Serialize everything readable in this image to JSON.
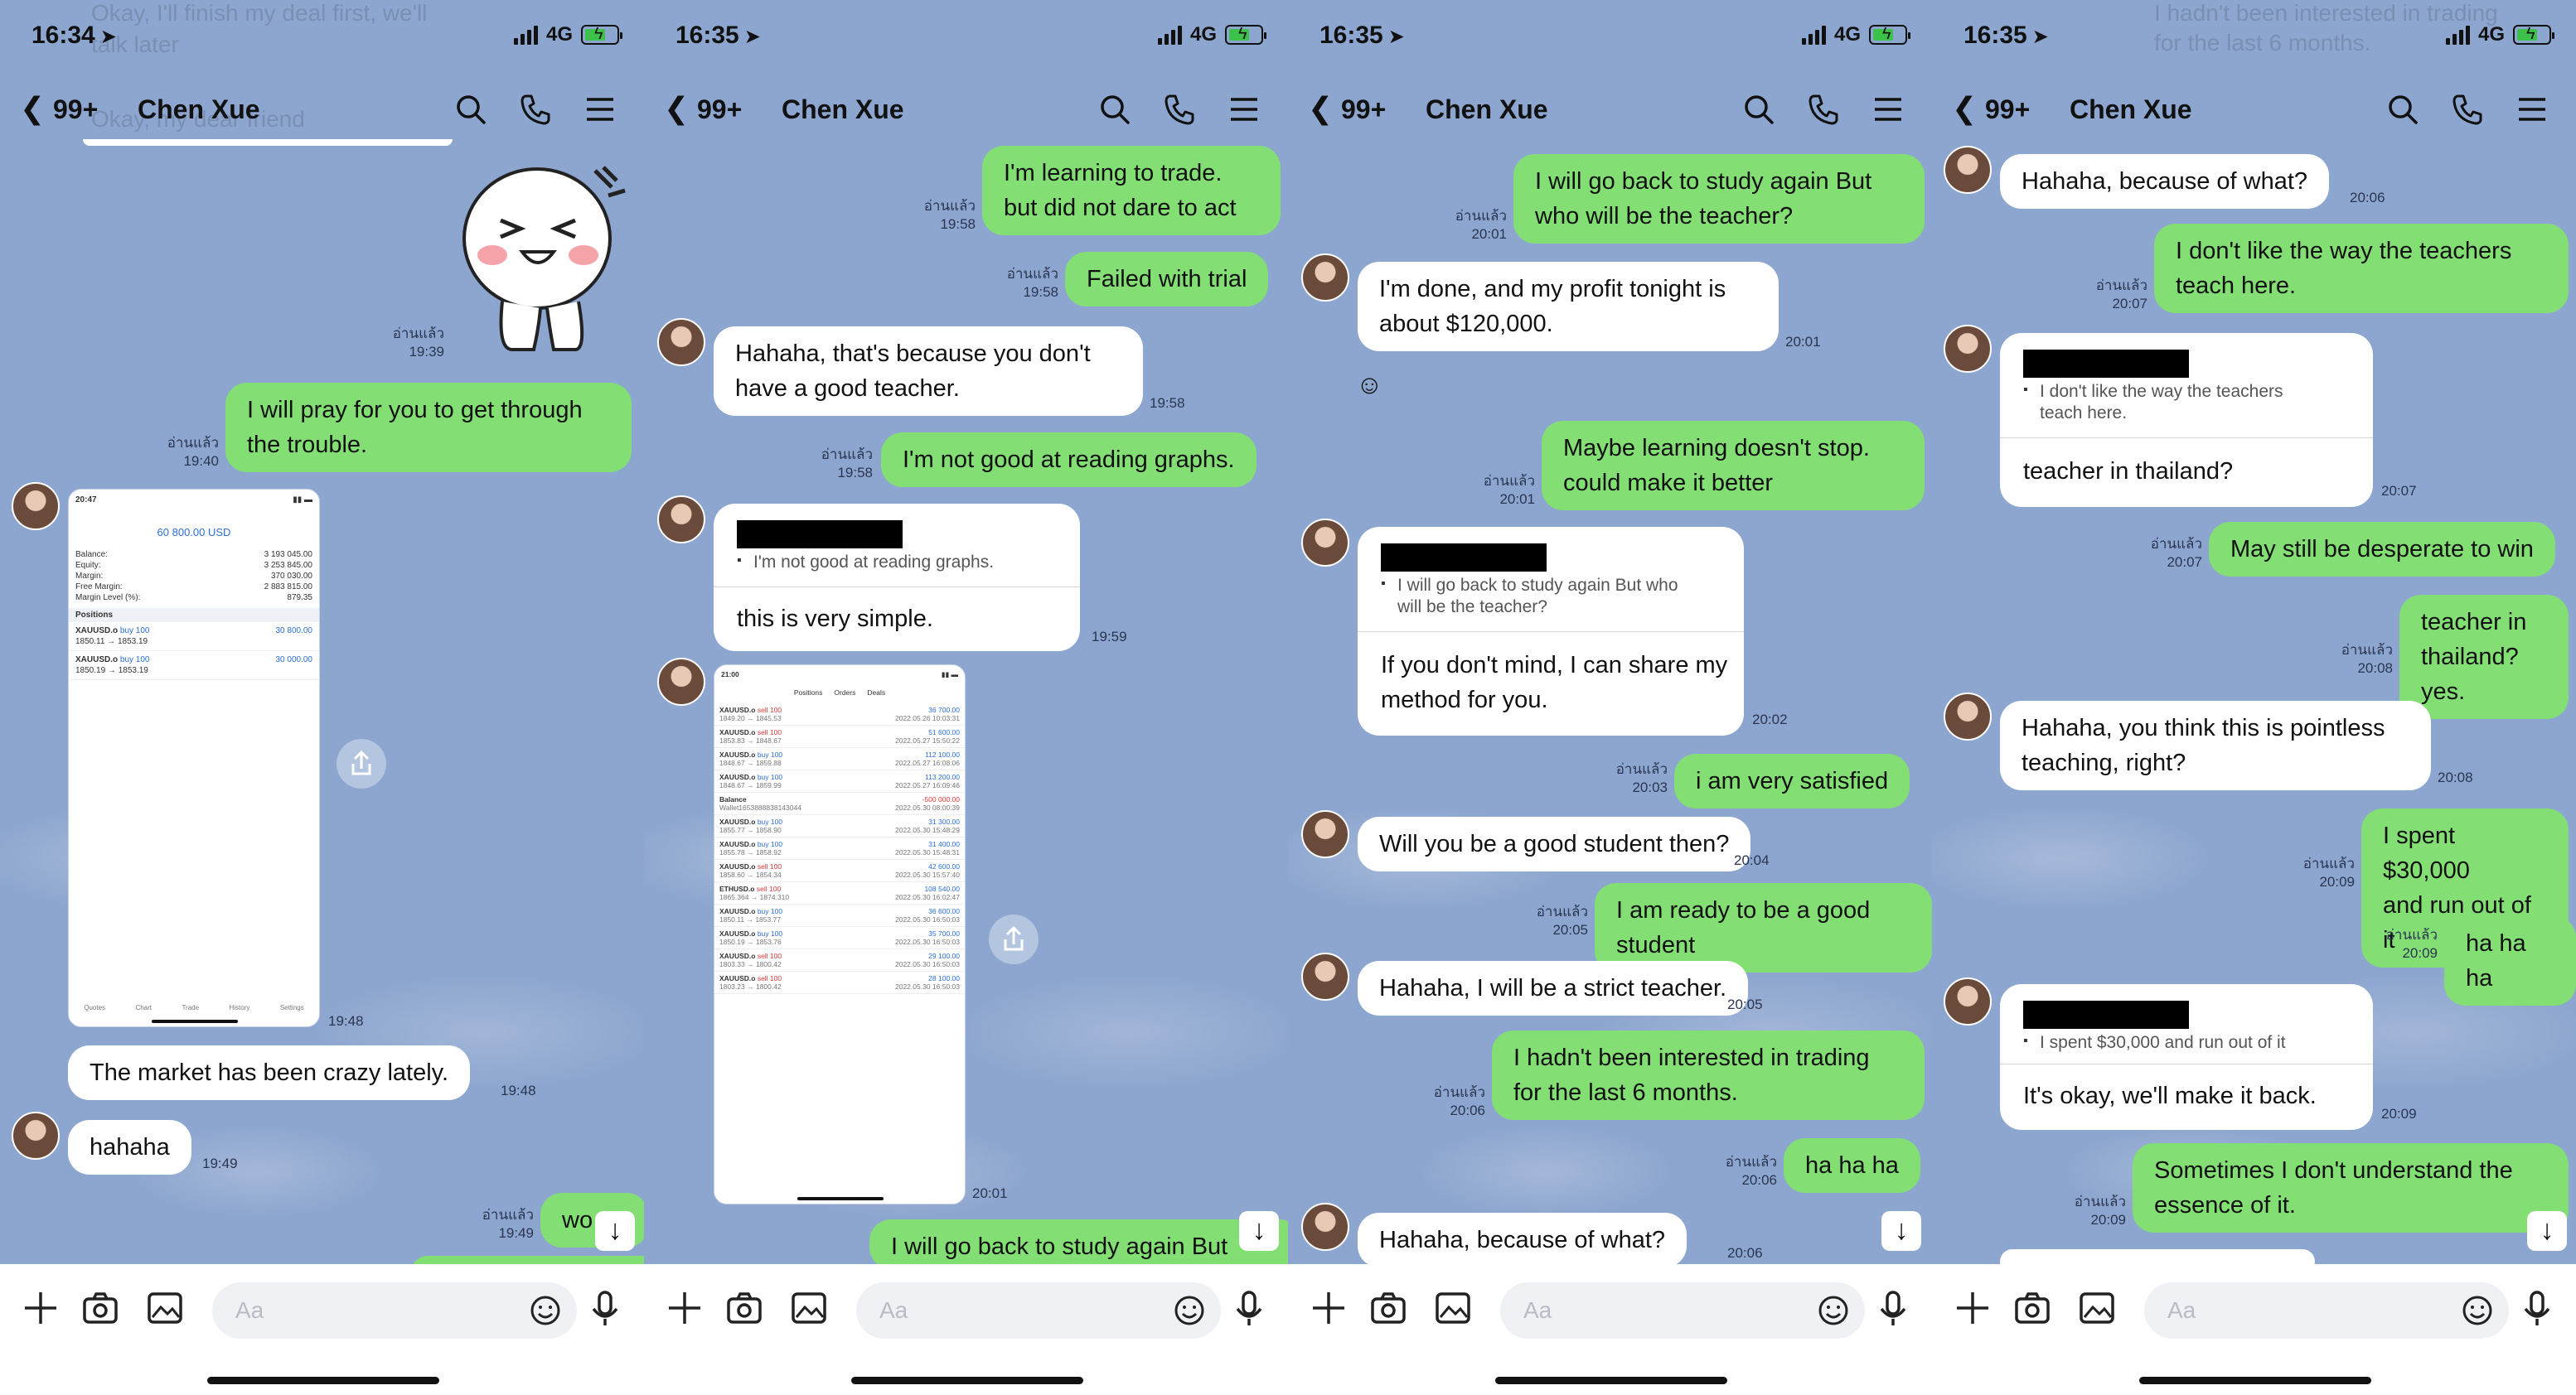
{
  "screens": [
    {
      "status": {
        "time": "16:34",
        "network": "4G"
      },
      "header": {
        "back_count": "99+",
        "contact": "Chen Xue"
      },
      "faded_top": [
        "Okay, I'll finish my deal first, we'll",
        "talk later",
        "Okay, my dear friend"
      ],
      "read_label": "อ่านแล้ว",
      "messages": {
        "m1_meta_read": "อ่านแล้ว",
        "m1_meta_time": "19:39",
        "m2_text": "I will pray for you to get through\nthe trouble.",
        "m2_time": "19:40",
        "img_time": "19:48",
        "m3_text": "The market has been crazy lately.",
        "m3_time": "19:48",
        "m4_text": "hahaha",
        "m4_time": "19:49",
        "m5_text": "wo",
        "m5_time": "19:49"
      },
      "trade_screen": {
        "time": "20:47",
        "balance_title": "60 800.00 USD",
        "rows": [
          [
            "Balance:",
            "3 193 045.00"
          ],
          [
            "Equity:",
            "3 253 845.00"
          ],
          [
            "Margin:",
            "370 030.00"
          ],
          [
            "Free Margin:",
            "2 883 815.00"
          ],
          [
            "Margin Level (%):",
            "879.35"
          ]
        ],
        "positions_label": "Positions",
        "positions": [
          {
            "sym": "XAUUSD.o",
            "side": "buy 100",
            "range": "1850.11 → 1853.19",
            "profit": "30 800.00"
          },
          {
            "sym": "XAUUSD.o",
            "side": "buy 100",
            "range": "1850.19 → 1853.19",
            "profit": "30 000.00"
          }
        ],
        "tabs": [
          "Quotes",
          "Chart",
          "Trade",
          "History",
          "Settings"
        ]
      },
      "input": {
        "placeholder": "Aa"
      }
    },
    {
      "status": {
        "time": "16:35",
        "network": "4G"
      },
      "header": {
        "back_count": "99+",
        "contact": "Chen Xue"
      },
      "messages": {
        "m1_text": "I'm learning to trade.\nbut did not dare to act",
        "m1_time": "19:58",
        "m2_text": "Failed with trial",
        "m2_time": "19:58",
        "m3_text": "Hahaha, that's because you don't\nhave a good teacher.",
        "m3_time": "19:58",
        "m4_text": "I'm not good at reading graphs.",
        "m4_time": "19:58",
        "m5_quote": "I'm not good at reading graphs.",
        "m5_text": "this is very simple.",
        "m5_time": "19:59",
        "img_time": "20:01",
        "m6_text": "I will go back to study again But"
      },
      "history_screen": {
        "time": "21:00",
        "tabs": [
          "Positions",
          "Orders",
          "Deals"
        ],
        "rows": [
          {
            "sym": "XAUUSD.o",
            "side": "sell 100",
            "range": "1849.20 → 1845.53",
            "date": "2022.05.26 10:03:31",
            "value": "36 700.00"
          },
          {
            "sym": "XAUUSD.o",
            "side": "sell 100",
            "range": "1853.83 → 1848.67",
            "date": "2022.05.27 15:50:22",
            "value": "51 600.00"
          },
          {
            "sym": "XAUUSD.o",
            "side": "buy 100",
            "range": "1848.67 → 1859.88",
            "date": "2022.05.27 16:08:06",
            "value": "112 100.00"
          },
          {
            "sym": "XAUUSD.o",
            "side": "buy 100",
            "range": "1848.67 → 1859.99",
            "date": "2022.05.27 16:09:46",
            "value": "113 200.00"
          },
          {
            "sym": "Balance",
            "side": "",
            "range": "Wallet1653888838143044",
            "date": "2022.05.30 08:00:39",
            "value": "-500 000.00"
          },
          {
            "sym": "XAUUSD.o",
            "side": "buy 100",
            "range": "1855.77 → 1858.90",
            "date": "2022.05.30 15:48:29",
            "value": "31 300.00"
          },
          {
            "sym": "XAUUSD.o",
            "side": "buy 100",
            "range": "1855.78 → 1858.92",
            "date": "2022.05.30 15:48:31",
            "value": "31 400.00"
          },
          {
            "sym": "XAUUSD.o",
            "side": "sell 100",
            "range": "1858.60 → 1854.34",
            "date": "2022.05.30 15:57:40",
            "value": "42 600.00"
          },
          {
            "sym": "ETHUSD.o",
            "side": "sell 100",
            "range": "1865.364 → 1874.310",
            "date": "2022.05.30 16:02:47",
            "value": "108 540.00"
          },
          {
            "sym": "XAUUSD.o",
            "side": "buy 100",
            "range": "1850.11 → 1853.77",
            "date": "2022.05.30 16:50:03",
            "value": "36 600.00"
          },
          {
            "sym": "XAUUSD.o",
            "side": "buy 100",
            "range": "1850.19 → 1853.76",
            "date": "2022.05.30 16:50:03",
            "value": "35 700.00"
          },
          {
            "sym": "XAUUSD.o",
            "side": "sell 100",
            "range": "1803.33 → 1800.42",
            "date": "2022.05.30 16:50:03",
            "value": "29 100.00"
          },
          {
            "sym": "XAUUSD.o",
            "side": "sell 100",
            "range": "1803.23 → 1800.42",
            "date": "2022.05.30 16:50:03",
            "value": "28 100.00"
          }
        ]
      },
      "input": {
        "placeholder": "Aa"
      }
    },
    {
      "status": {
        "time": "16:35",
        "network": "4G"
      },
      "header": {
        "back_count": "99+",
        "contact": "Chen Xue"
      },
      "messages": {
        "m1_text": "I will go back to study again But\nwho will be the teacher?",
        "m1_time": "20:01",
        "m2_text": "I'm done, and my profit tonight is\nabout $120,000.",
        "m2_time": "20:01",
        "m3_text": "Maybe learning doesn't stop.\ncould make it better",
        "m3_time": "20:01",
        "m4_quote": "I will go back to study again But who\nwill be the teacher?",
        "m4_text": "If you don't mind, I can share my\nmethod for you.",
        "m4_time": "20:02",
        "m5_text": "i am very satisfied",
        "m5_time": "20:03",
        "m6_text": "Will you be a good student then?",
        "m6_time": "20:04",
        "m7_text": "I am ready to be a good student",
        "m7_time": "20:05",
        "m8_text": "Hahaha, I will be a strict teacher.",
        "m8_time": "20:05",
        "m9_text": "I hadn't been interested in trading\nfor the last 6 months.",
        "m9_time": "20:06",
        "m10_text": "ha ha ha",
        "m10_time": "20:06",
        "m11_text": "Hahaha, because of what?",
        "m11_time": "20:06"
      },
      "input": {
        "placeholder": "Aa"
      }
    },
    {
      "status": {
        "time": "16:35",
        "network": "4G"
      },
      "header": {
        "back_count": "99+",
        "contact": "Chen Xue"
      },
      "faded_top": [
        "I hadn't been interested in trading",
        "for the last 6 months."
      ],
      "messages": {
        "m1_text": "Hahaha, because of what?",
        "m1_time": "20:06",
        "m2_text": "I don't like the way the teachers\nteach here.",
        "m2_time": "20:07",
        "m3_quote": "I don't like the way the teachers\nteach here.",
        "m3_text": "teacher in thailand?",
        "m3_time": "20:07",
        "m4_text": "May still be desperate to win",
        "m4_time": "20:07",
        "m5_text": "teacher in thailand?\nyes.",
        "m5_time": "20:08",
        "m6_text": "Hahaha, you think this is pointless\nteaching, right?",
        "m6_time": "20:08",
        "m7_text": "I spent $30,000\nand run out of it",
        "m7_time": "20:09",
        "m8_text": "ha ha ha",
        "m8_time": "20:09",
        "m9_quote": "I spent $30,000 and run out of it",
        "m9_text": "It's okay, we'll make it back.",
        "m9_time": "20:09",
        "m10_text": "Sometimes I don't understand the\nessence of it.",
        "m10_time": "20:09"
      },
      "input": {
        "placeholder": "Aa"
      }
    }
  ],
  "colors": {
    "chat_bg": "#8da6cf",
    "outgoing": "#83df74",
    "incoming": "#ffffff"
  },
  "icons": [
    "back-chevron-icon",
    "search-icon",
    "phone-icon",
    "menu-icon",
    "plus-icon",
    "camera-icon",
    "image-icon",
    "emoji-icon",
    "mic-icon",
    "share-icon",
    "scroll-down-icon"
  ]
}
